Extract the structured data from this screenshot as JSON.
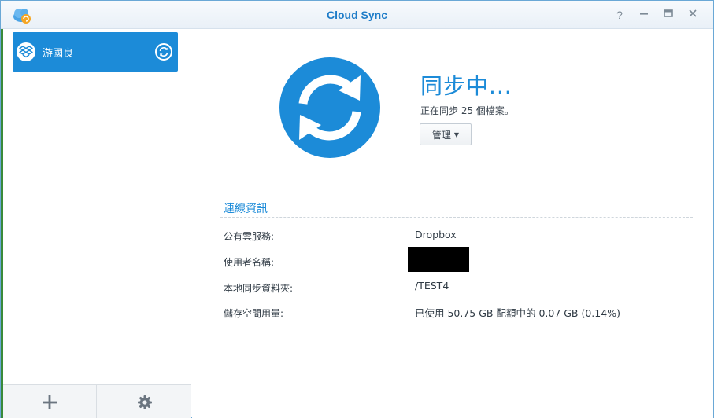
{
  "window": {
    "title": "Cloud Sync",
    "help_glyph": "?",
    "colors": {
      "accent": "#1c8bd8",
      "title": "#1e7cc8"
    }
  },
  "sidebar": {
    "tasks": [
      {
        "label": "游國良",
        "icon": "dropbox-icon",
        "status_icon": "sync-icon"
      }
    ],
    "footer": {
      "add_icon": "plus-icon",
      "settings_icon": "gear-icon"
    }
  },
  "status": {
    "title": "同步中...",
    "subtitle": "正在同步 25 個檔案。",
    "manage_label": "管理"
  },
  "connection": {
    "section_title": "連線資訊",
    "rows": [
      {
        "label": "公有雲服務:",
        "value": "Dropbox"
      },
      {
        "label": "使用者名稱:",
        "value": ""
      },
      {
        "label": "本地同步資料夾:",
        "value": "/TEST4"
      },
      {
        "label": "儲存空間用量:",
        "value": "已使用 50.75 GB 配額中的 0.07 GB (0.14%)"
      }
    ]
  }
}
